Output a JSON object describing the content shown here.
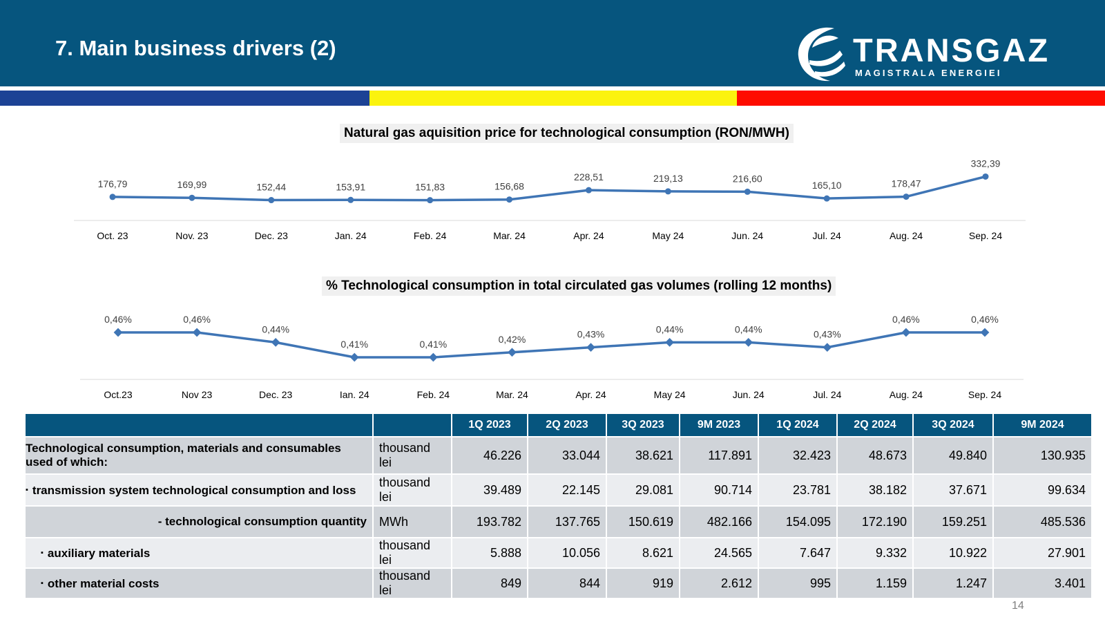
{
  "header": {
    "title": "7. Main business drivers (2)",
    "logo_word": "TRANSGAZ",
    "logo_tagline": "MAGISTRALA ENERGIEI",
    "background_color": "#06557e"
  },
  "stripe_colors": [
    "#1c4295",
    "#fbf30e",
    "#fe0c00"
  ],
  "line_color": "#3f75b5",
  "chart_data": [
    {
      "type": "line",
      "title": "Natural gas aquisition price for technological consumption (RON/MWH)",
      "categories": [
        "Oct. 23",
        "Nov. 23",
        "Dec. 23",
        "Jan. 24",
        "Feb. 24",
        "Mar. 24",
        "Apr. 24",
        "May 24",
        "Jun. 24",
        "Jul. 24",
        "Aug. 24",
        "Sep. 24"
      ],
      "values": [
        176.79,
        169.99,
        152.44,
        153.91,
        151.83,
        156.68,
        228.51,
        219.13,
        216.6,
        165.1,
        178.47,
        332.39
      ],
      "data_labels": [
        "176,79",
        "169,99",
        "152,44",
        "153,91",
        "151,83",
        "156,68",
        "228,51",
        "219,13",
        "216,60",
        "165,10",
        "178,47",
        "332,39"
      ],
      "xlabel": "",
      "ylabel": "",
      "grid": false,
      "legend": "none"
    },
    {
      "type": "line",
      "title": "% Technological consumption in total circulated gas volumes (rolling 12 months)",
      "categories": [
        "Oct.23",
        "Nov 23",
        "Dec. 23",
        "Ian. 24",
        "Feb. 24",
        "Mar. 24",
        "Apr. 24",
        "May 24",
        "Jun. 24",
        "Jul. 24",
        "Aug. 24",
        "Sep. 24"
      ],
      "values": [
        0.46,
        0.46,
        0.44,
        0.41,
        0.41,
        0.42,
        0.43,
        0.44,
        0.44,
        0.43,
        0.46,
        0.46
      ],
      "data_labels": [
        "0,46%",
        "0,46%",
        "0,44%",
        "0,41%",
        "0,41%",
        "0,42%",
        "0,43%",
        "0,44%",
        "0,44%",
        "0,43%",
        "0,46%",
        "0,46%"
      ],
      "xlabel": "",
      "ylabel": "",
      "grid": false,
      "legend": "none"
    }
  ],
  "table": {
    "headers": [
      "",
      "",
      "1Q 2023",
      "2Q 2023",
      "3Q 2023",
      "9M 2023",
      "1Q 2024",
      "2Q 2024",
      "3Q 2024",
      "9M 2024"
    ],
    "rows": [
      {
        "label": "Technological consumption, materials and consumables used of which:",
        "bullet": "",
        "unit": "thousand lei",
        "values": [
          "46.226",
          "33.044",
          "38.621",
          "117.891",
          "32.423",
          "48.673",
          "49.840",
          "130.935"
        ]
      },
      {
        "label": "transmission system technological consumption and loss",
        "bullet": "▪",
        "unit": "thousand lei",
        "values": [
          "39.489",
          "22.145",
          "29.081",
          "90.714",
          "23.781",
          "38.182",
          "37.671",
          "99.634"
        ]
      },
      {
        "label": "- technological consumption quantity",
        "bullet": "",
        "unit": "MWh",
        "values": [
          "193.782",
          "137.765",
          "150.619",
          "482.166",
          "154.095",
          "172.190",
          "159.251",
          "485.536"
        ]
      },
      {
        "label": "auxiliary materials",
        "bullet": "▪",
        "unit": "thousand lei",
        "values": [
          "5.888",
          "10.056",
          "8.621",
          "24.565",
          "7.647",
          "9.332",
          "10.922",
          "27.901"
        ]
      },
      {
        "label": "other material costs",
        "bullet": "▪",
        "unit": "thousand lei",
        "values": [
          "849",
          "844",
          "919",
          "2.612",
          "995",
          "1.159",
          "1.247",
          "3.401"
        ]
      }
    ]
  },
  "page_number": "14"
}
